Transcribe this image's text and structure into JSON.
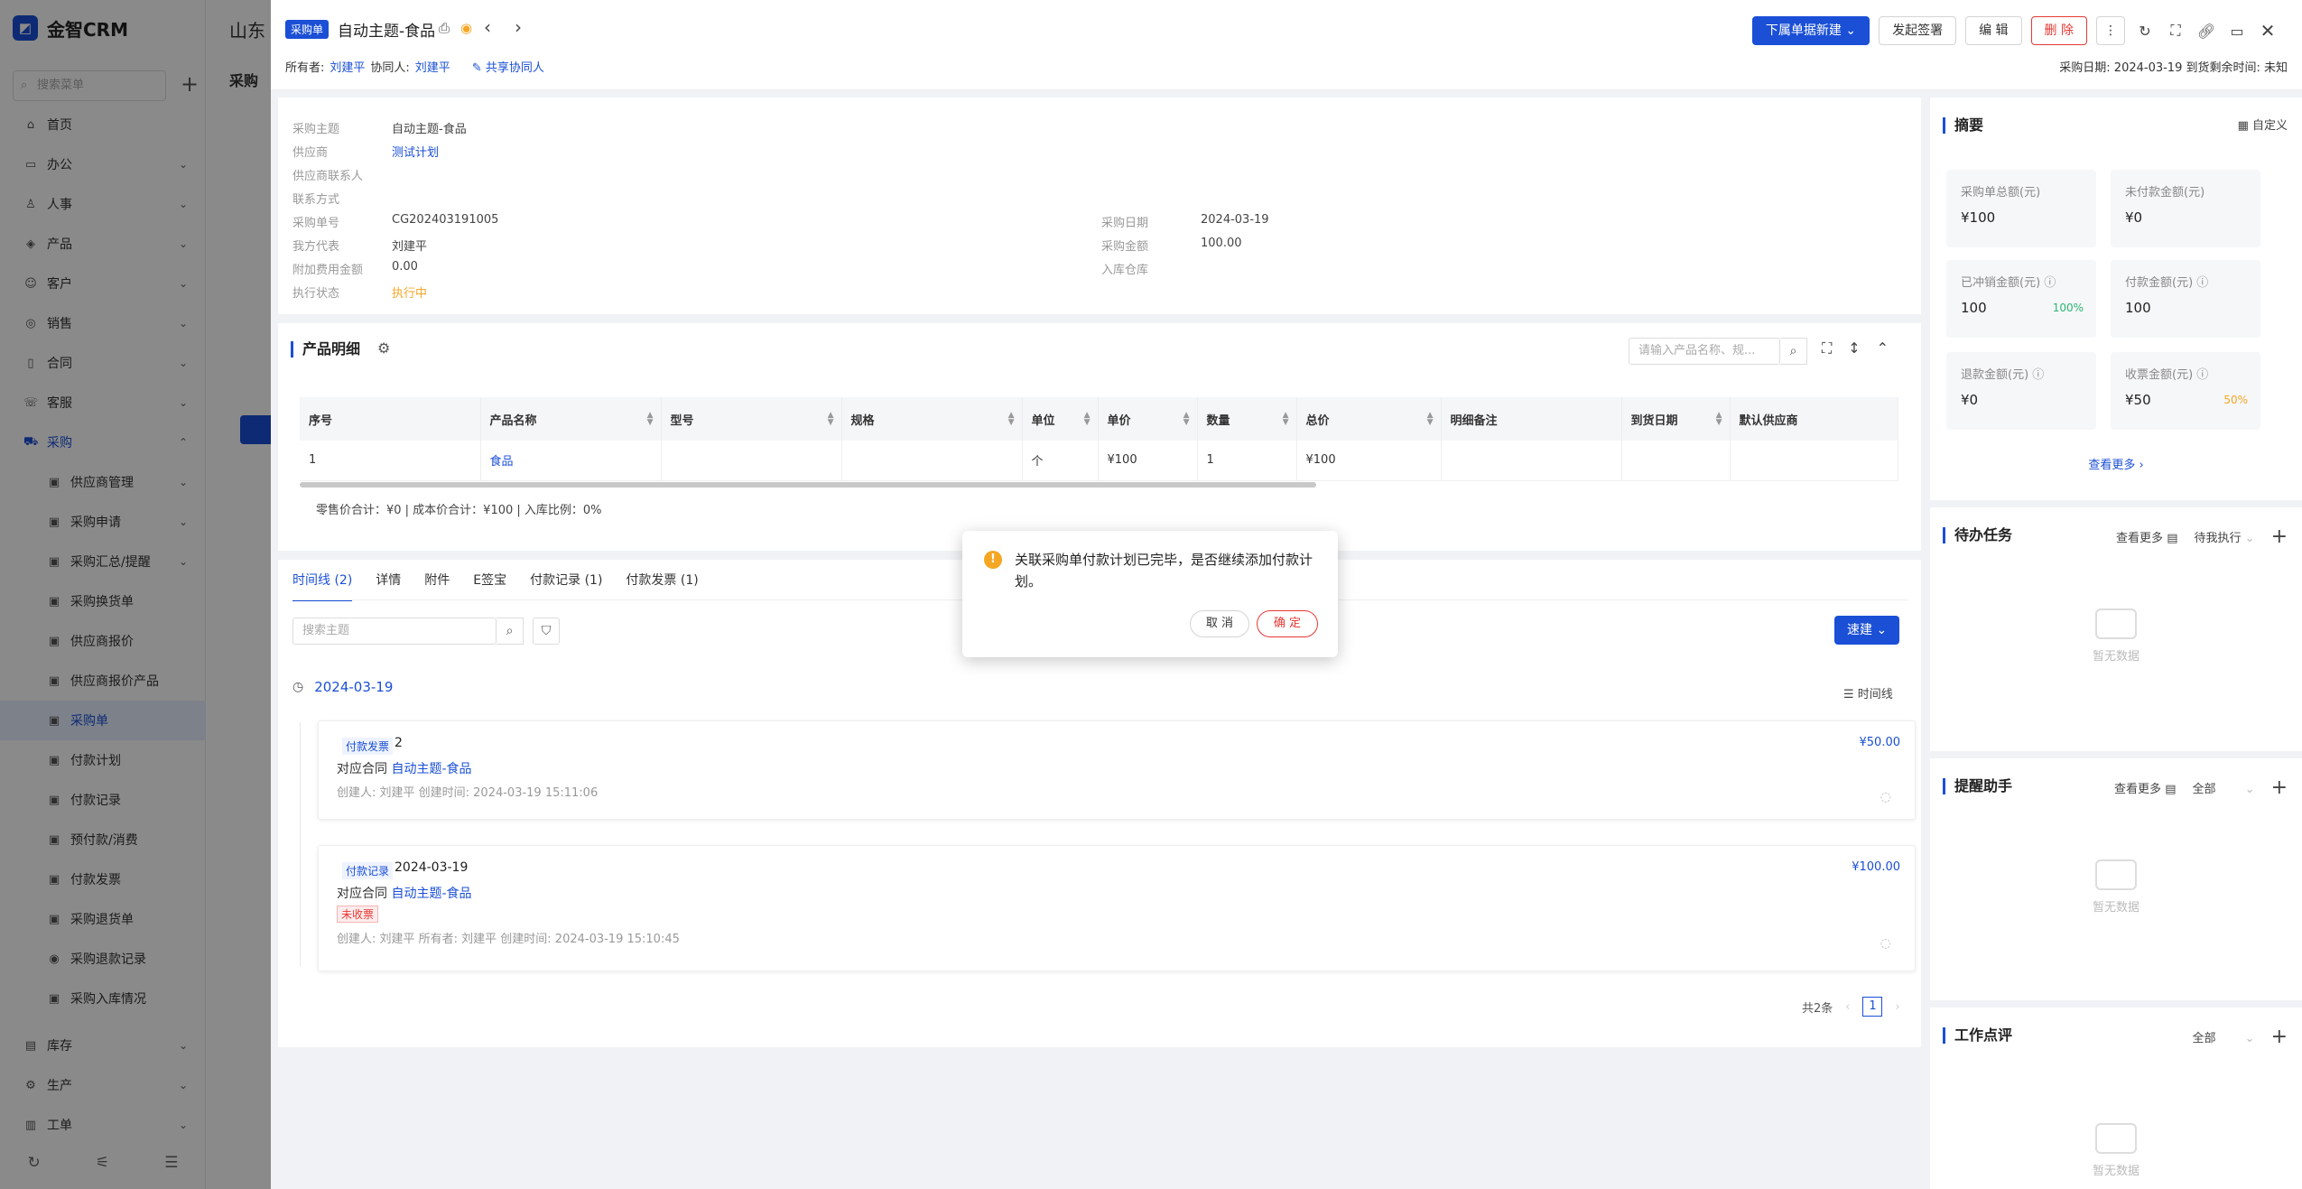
{
  "app": {
    "brand": "金智CRM",
    "bg_title": "山东",
    "bg_tab": "采购",
    "search_placeholder": "搜索菜单",
    "menu": [
      "首页",
      "办公",
      "人事",
      "产品",
      "客户",
      "销售",
      "合同",
      "客服",
      "采购"
    ],
    "procurement_sub": [
      "供应商管理",
      "采购申请",
      "采购汇总/提醒",
      "采购换货单",
      "供应商报价",
      "供应商报价产品",
      "采购单",
      "付款计划",
      "付款记录",
      "预付款/消费",
      "付款发票",
      "采购退货单",
      "采购退款记录",
      "采购入库情况"
    ],
    "menu_bottom": [
      "库存",
      "生产",
      "工单"
    ]
  },
  "drawer": {
    "type_tag": "采购单",
    "title": "自动主题-食品",
    "owner_label": "所有者:",
    "owner": "刘建平",
    "collab_label": "协同人:",
    "collab": "刘建平",
    "share": "共享协同人",
    "actions": {
      "new_sub": "下属单据新建",
      "sign": "发起签署",
      "edit": "编 辑",
      "delete": "删 除"
    },
    "dates": "采购日期:  2024-03-19   到货剩余时间:  未知"
  },
  "info": {
    "left": [
      {
        "k": "采购主题",
        "v": "自动主题-食品"
      },
      {
        "k": "供应商",
        "v": "测试计划"
      },
      {
        "k": "供应商联系人",
        "v": ""
      },
      {
        "k": "联系方式",
        "v": ""
      },
      {
        "k": "采购单号",
        "v": "CG202403191005"
      },
      {
        "k": "我方代表",
        "v": "刘建平"
      },
      {
        "k": "附加费用金额",
        "v": "0.00"
      },
      {
        "k": "执行状态",
        "v": "执行中"
      }
    ],
    "right": [
      {
        "k": "采购日期",
        "v": "2024-03-19"
      },
      {
        "k": "采购金额",
        "v": "100.00"
      },
      {
        "k": "入库仓库",
        "v": ""
      }
    ]
  },
  "products": {
    "title": "产品明细",
    "search_placeholder": "请输入产品名称、规...",
    "columns": [
      "序号",
      "产品名称",
      "型号",
      "规格",
      "单位",
      "单价",
      "数量",
      "总价",
      "明细备注",
      "到货日期",
      "默认供应商"
    ],
    "rows": [
      [
        "1",
        "食品",
        "",
        "",
        "个",
        "¥100",
        "1",
        "¥100",
        "",
        "",
        ""
      ]
    ],
    "summary": "零售价合计：¥0 |   成本价合计：¥100 |    入库比例：0%"
  },
  "timeline": {
    "tabs": [
      "时间线 (2)",
      "详情",
      "附件",
      "E签宝",
      "付款记录 (1)",
      "付款发票 (1)"
    ],
    "search_placeholder": "搜索主题",
    "quick": "速建",
    "date": "2024-03-19",
    "mode": "时间线",
    "cards": [
      {
        "type": "付款发票",
        "value": "2",
        "amount": "¥50.00",
        "contract_label": "对应合同",
        "contract": "自动主题-食品",
        "meta": "创建人: 刘建平    创建时间: 2024-03-19 15:11:06"
      },
      {
        "type": "付款记录",
        "value": "2024-03-19",
        "amount": "¥100.00",
        "contract_label": "对应合同",
        "contract": "自动主题-食品",
        "badge": "未收票",
        "meta": "创建人: 刘建平    所有者: 刘建平    创建时间: 2024-03-19 15:10:45"
      }
    ],
    "total": "共2条",
    "page": "1"
  },
  "summary": {
    "title": "摘要",
    "custom": "自定义",
    "stats": [
      {
        "label": "采购单总额(元)",
        "value": "¥100",
        "pct": ""
      },
      {
        "label": "未付款金额(元)",
        "value": "¥0",
        "pct": ""
      },
      {
        "label": "已冲销金额(元)",
        "value": "100",
        "pct": "100%"
      },
      {
        "label": "付款金额(元)",
        "value": "100",
        "pct": ""
      },
      {
        "label": "退款金额(元)",
        "value": "¥0",
        "pct": ""
      },
      {
        "label": "收票金额(元)",
        "value": "¥50",
        "pct": "50%"
      }
    ],
    "more": "查看更多"
  },
  "todo": {
    "title": "待办任务",
    "more": "查看更多",
    "filter": "待我执行",
    "empty": "暂无数据"
  },
  "reminder": {
    "title": "提醒助手",
    "more": "查看更多",
    "filter": "全部",
    "empty": "暂无数据"
  },
  "review": {
    "title": "工作点评",
    "filter": "全部",
    "empty": "暂无数据"
  },
  "dialog": {
    "message": "关联采购单付款计划已完毕，是否继续添加付款计划。",
    "cancel": "取 消",
    "ok": "确 定"
  },
  "colors": {
    "primary": "#1a4fd6",
    "danger": "#e53935",
    "warning": "#f5a623",
    "success": "#2bb673"
  }
}
